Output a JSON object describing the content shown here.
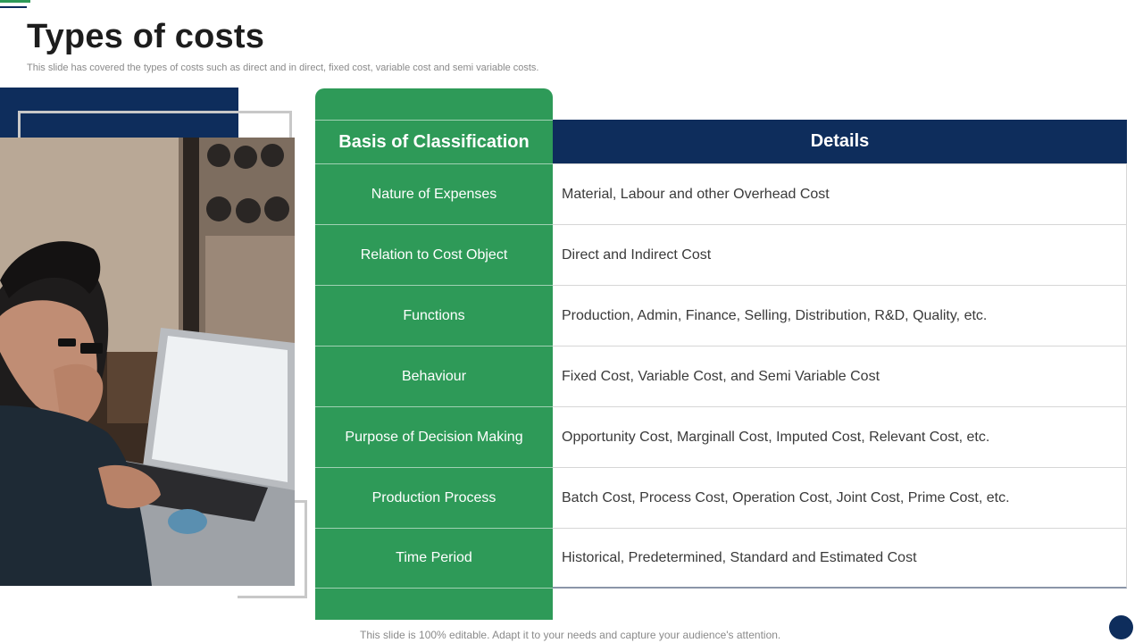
{
  "slide": {
    "title": "Types of costs",
    "subtitle": "This slide has covered the types of costs such as direct and in direct, fixed cost, variable cost and semi variable costs.",
    "footer": "This slide is 100% editable. Adapt it to your needs and capture your audience's attention."
  },
  "table": {
    "header_left": "Basis of Classification",
    "header_right": "Details",
    "rows": [
      {
        "basis": "Nature of Expenses",
        "details": "Material, Labour and other Overhead Cost"
      },
      {
        "basis": "Relation to Cost Object",
        "details": "Direct and Indirect Cost"
      },
      {
        "basis": "Functions",
        "details": "Production, Admin, Finance, Selling, Distribution, R&D, Quality, etc."
      },
      {
        "basis": "Behaviour",
        "details": "Fixed Cost, Variable Cost, and Semi Variable Cost"
      },
      {
        "basis": "Purpose of Decision Making",
        "details": "Opportunity Cost, Marginall Cost, Imputed Cost, Relevant Cost, etc."
      },
      {
        "basis": "Production Process",
        "details": "Batch Cost, Process Cost, Operation Cost, Joint Cost, Prime Cost, etc."
      },
      {
        "basis": "Time Period",
        "details": "Historical, Predetermined, Standard and Estimated Cost"
      }
    ]
  },
  "colors": {
    "green": "#2e9a58",
    "navy": "#0e2d5c",
    "frame_gray": "#c8c8c8"
  },
  "icons": {
    "photo": "man-with-laptop-photo",
    "corner_dot": "navy-circle"
  }
}
